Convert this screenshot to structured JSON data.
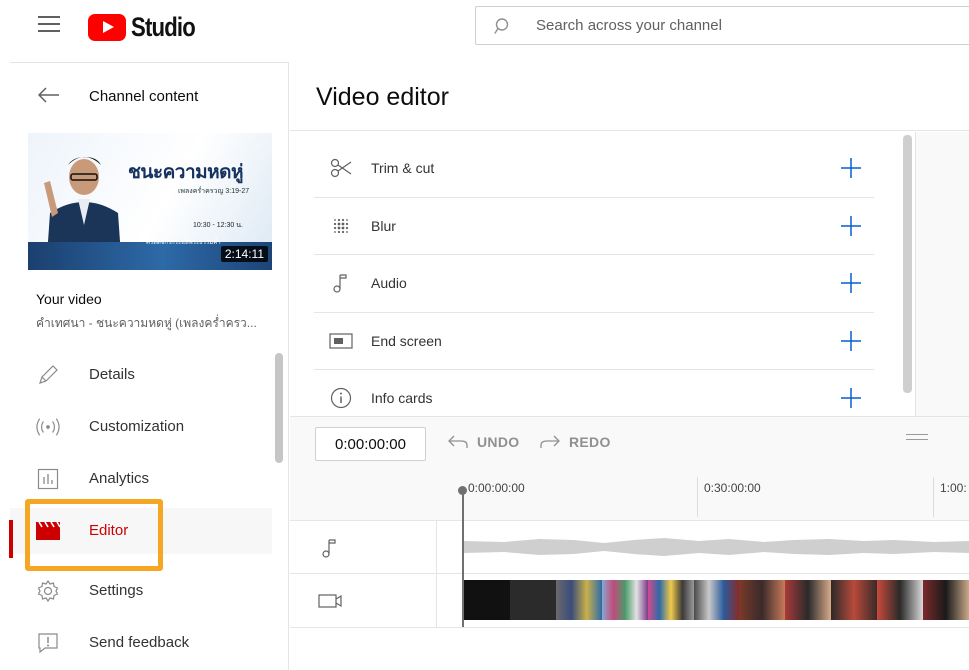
{
  "app": {
    "brand": "Studio"
  },
  "search": {
    "placeholder": "Search across your channel"
  },
  "sidebar": {
    "back_label": "Channel content",
    "thumbnail": {
      "title_text": "ชนะความหดหู่",
      "subtitle_text": "เพลงคร่ำครวญ 3:19-27",
      "time_text": "10:30 - 12:30 น.",
      "brand_text": "คริสตจักรกระแสพระธรรมค้ำ",
      "duration": "2:14:11"
    },
    "your_video_label": "Your video",
    "video_title": "คำเทศนา - ชนะความหดหู่ (เพลงคร่ำครว...",
    "items": [
      {
        "label": "Details",
        "icon": "pencil-icon",
        "active": false
      },
      {
        "label": "Customization",
        "icon": "broadcast-icon",
        "active": false
      },
      {
        "label": "Analytics",
        "icon": "analytics-icon",
        "active": false
      },
      {
        "label": "Editor",
        "icon": "clapperboard-icon",
        "active": true
      },
      {
        "label": "Settings",
        "icon": "gear-icon",
        "active": false
      },
      {
        "label": "Send feedback",
        "icon": "feedback-icon",
        "active": false
      }
    ]
  },
  "main": {
    "title": "Video editor",
    "tools": [
      {
        "label": "Trim & cut",
        "icon": "scissors-icon"
      },
      {
        "label": "Blur",
        "icon": "blur-icon"
      },
      {
        "label": "Audio",
        "icon": "music-note-icon"
      },
      {
        "label": "End screen",
        "icon": "end-screen-icon"
      },
      {
        "label": "Info cards",
        "icon": "info-icon"
      }
    ]
  },
  "timeline": {
    "timecode": "0:00:00:00",
    "undo_label": "UNDO",
    "redo_label": "REDO",
    "ruler": [
      "0:00:00:00",
      "0:30:00:00",
      "1:00:"
    ]
  },
  "colors": {
    "accent_red": "#cc0000",
    "youtube_red": "#ff0000",
    "tool_plus_blue": "#065fd4",
    "highlight_orange": "#f5a623"
  }
}
